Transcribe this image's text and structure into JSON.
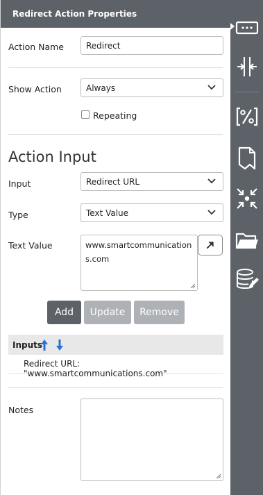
{
  "panel": {
    "title": "Redirect Action Properties"
  },
  "action_name": {
    "label": "Action Name",
    "value": "Redirect"
  },
  "show_action": {
    "label": "Show Action",
    "value": "Always"
  },
  "repeating": {
    "label": "Repeating",
    "checked": false
  },
  "action_input": {
    "heading": "Action Input",
    "input": {
      "label": "Input",
      "value": "Redirect URL"
    },
    "type": {
      "label": "Type",
      "value": "Text Value"
    },
    "text_value": {
      "label": "Text Value",
      "value": "www.smartcommunications.com"
    }
  },
  "buttons": {
    "add": "Add",
    "update": "Update",
    "remove": "Remove"
  },
  "inputs_list": {
    "header": "Inputs",
    "rows": [
      "Redirect URL: \"www.smartcommunications.com\""
    ]
  },
  "notes": {
    "label": "Notes",
    "value": ""
  },
  "rail_icons": [
    "action-properties-icon",
    "split-merge-icon",
    "percent-code-icon",
    "bookmark-page-icon",
    "collapse-arrows-icon",
    "folder-icon",
    "database-edit-icon"
  ],
  "colors": {
    "header": "#5d6168",
    "add_button": "#5d6168",
    "disabled_button": "#aeb1b6",
    "arrow_blue": "#2a6fd6"
  }
}
